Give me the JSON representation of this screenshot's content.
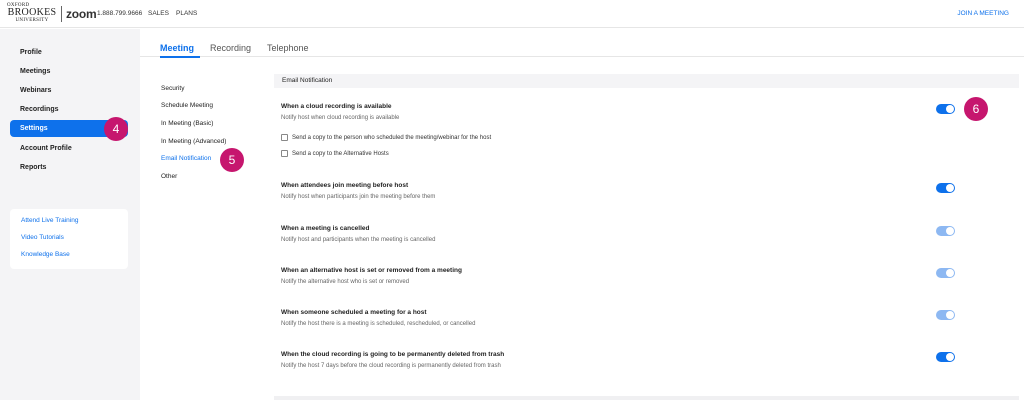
{
  "topbar": {
    "logo": {
      "line1": "OXFORD",
      "line2": "BROOKES",
      "line3": "UNIVERSITY"
    },
    "zoom_logo": "zoom",
    "phone": "1.888.799.9666",
    "nav": {
      "sales": "SALES",
      "plans": "PLANS"
    },
    "join_link": "JOIN A MEETING"
  },
  "sidebar": {
    "items": [
      {
        "label": "Profile"
      },
      {
        "label": "Meetings"
      },
      {
        "label": "Webinars"
      },
      {
        "label": "Recordings"
      },
      {
        "label": "Settings",
        "active": true
      },
      {
        "label": "Account Profile"
      },
      {
        "label": "Reports"
      }
    ],
    "help_links": [
      {
        "label": "Attend Live Training"
      },
      {
        "label": "Video Tutorials"
      },
      {
        "label": "Knowledge Base"
      }
    ]
  },
  "badges": {
    "b4": "4",
    "b5": "5",
    "b6": "6"
  },
  "tabs": [
    {
      "label": "Meeting",
      "active": true
    },
    {
      "label": "Recording"
    },
    {
      "label": "Telephone"
    }
  ],
  "subnav": [
    {
      "label": "Security"
    },
    {
      "label": "Schedule Meeting"
    },
    {
      "label": "In Meeting (Basic)"
    },
    {
      "label": "In Meeting (Advanced)"
    },
    {
      "label": "Email Notification",
      "active": true
    },
    {
      "label": "Other"
    }
  ],
  "main": {
    "section_header": "Email Notification",
    "settings": [
      {
        "title": "When a cloud recording is available",
        "desc": "Notify host when cloud recording is available",
        "enabled": true,
        "locked": false
      },
      {
        "title": "When attendees join meeting before host",
        "desc": "Notify host when participants join the meeting before them",
        "enabled": true,
        "locked": false
      },
      {
        "title": "When a meeting is cancelled",
        "desc": "Notify host and participants when the meeting is cancelled",
        "enabled": true,
        "locked": true
      },
      {
        "title": "When an alternative host is set or removed from a meeting",
        "desc": "Notify the alternative host who is set or removed",
        "enabled": true,
        "locked": true
      },
      {
        "title": "When someone scheduled a meeting for a host",
        "desc": "Notify the host there is a meeting is scheduled, rescheduled, or cancelled",
        "enabled": true,
        "locked": true
      },
      {
        "title": "When the cloud recording is going to be permanently deleted from trash",
        "desc": "Notify the host 7 days before the cloud recording is permanently deleted from trash",
        "enabled": true,
        "locked": false
      }
    ],
    "checkboxes": [
      {
        "label": "Send a copy to the person who scheduled the meeting/webinar for the host",
        "checked": false
      },
      {
        "label": "Send a copy to the Alternative Hosts",
        "checked": false
      }
    ]
  },
  "colors": {
    "accent": "#0e71eb",
    "badge": "#c6166e",
    "sidebar_bg": "#f4f4f6"
  }
}
